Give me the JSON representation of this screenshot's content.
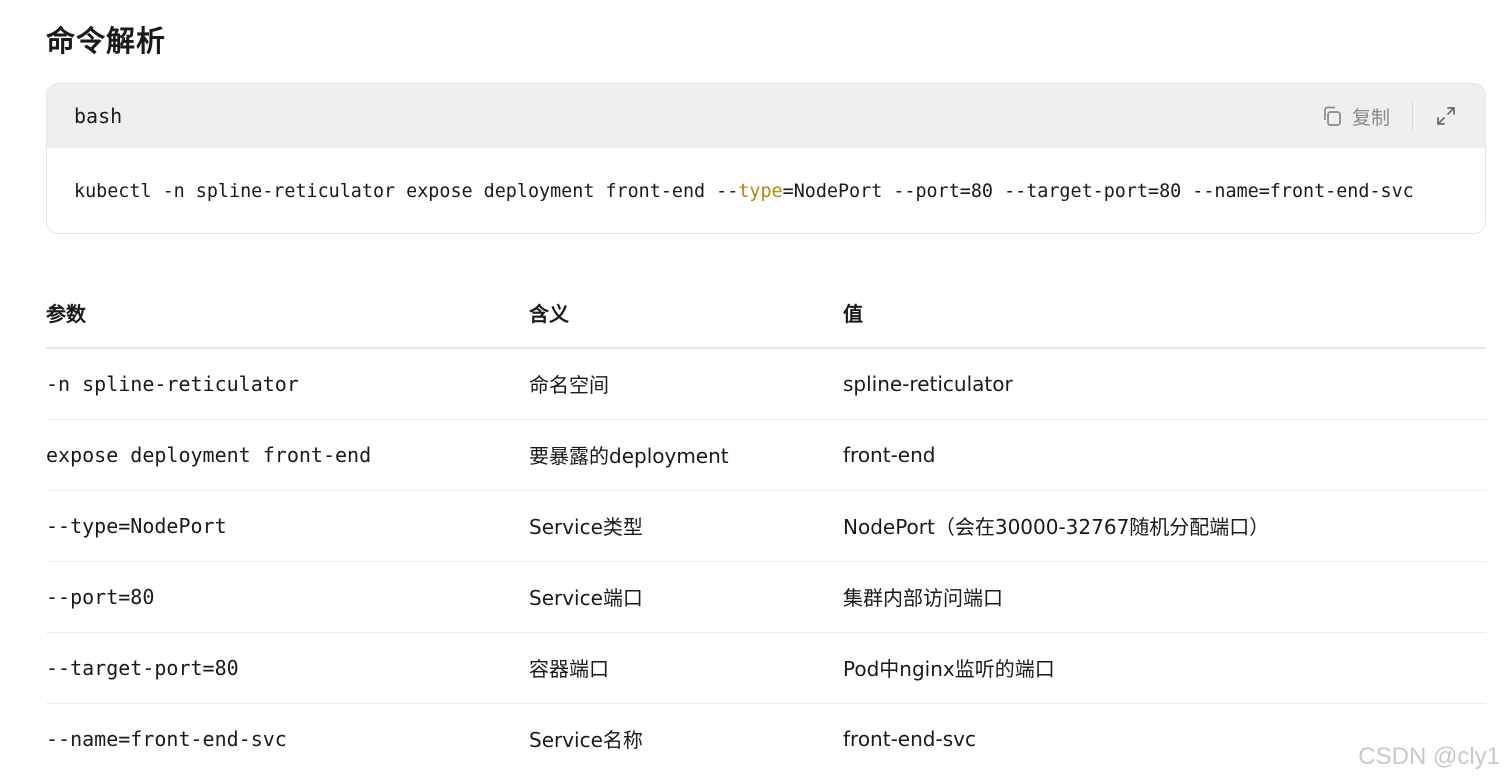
{
  "heading": "命令解析",
  "code_block": {
    "language": "bash",
    "copy_label": "复制",
    "command_prefix": "kubectl -n spline-reticulator expose deployment front-end --",
    "command_keyword": "type",
    "command_suffix": "=NodePort --port=80 --target-port=80 --name=front-end-svc",
    "keyword_color": "#b8860b",
    "icons": [
      "copy-icon",
      "expand-icon"
    ]
  },
  "table": {
    "headers": [
      "参数",
      "含义",
      "值"
    ],
    "rows": [
      {
        "param": "-n spline-reticulator",
        "meaning": "命名空间",
        "value": "spline-reticulator"
      },
      {
        "param": "expose deployment front-end",
        "meaning": "要暴露的deployment",
        "value": "front-end"
      },
      {
        "param": "--type=NodePort",
        "meaning": "Service类型",
        "value": "NodePort（会在30000-32767随机分配端口）"
      },
      {
        "param": "--port=80",
        "meaning": "Service端口",
        "value": "集群内部访问端口"
      },
      {
        "param": "--target-port=80",
        "meaning": "容器端口",
        "value": "Pod中nginx监听的端口"
      },
      {
        "param": "--name=front-end-svc",
        "meaning": "Service名称",
        "value": "front-end-svc"
      }
    ]
  },
  "watermark": "CSDN @cly1"
}
